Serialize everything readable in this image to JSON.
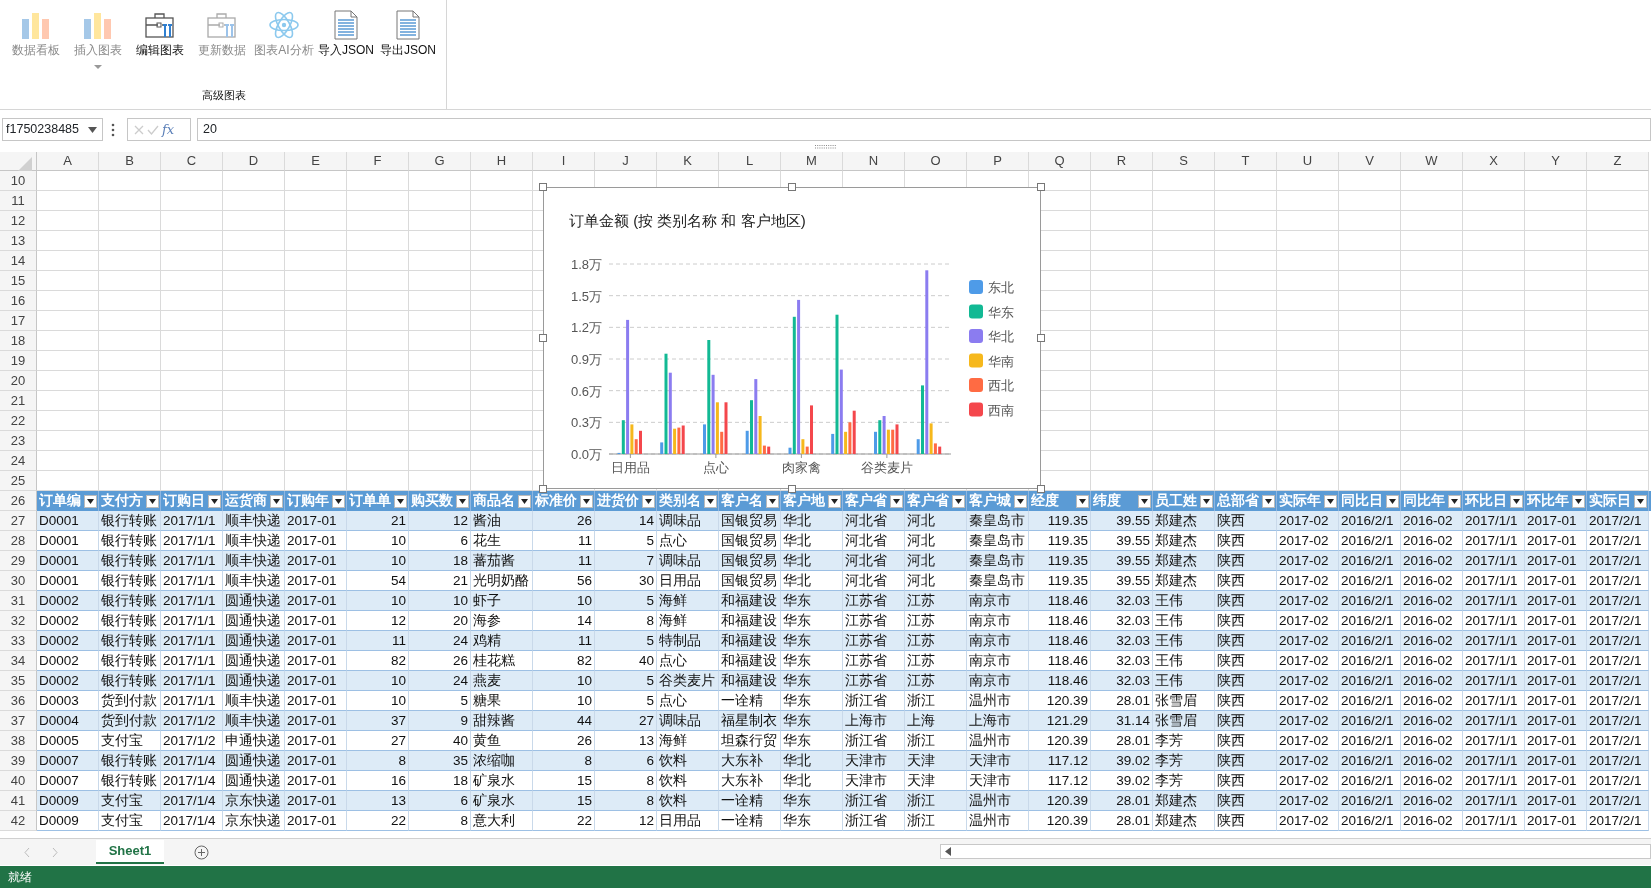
{
  "ribbon": {
    "buttons": [
      {
        "label": "数据看板",
        "kind": "bars",
        "disabled": true,
        "dropdown": false
      },
      {
        "label": "插入图表",
        "kind": "bars",
        "disabled": true,
        "dropdown": true
      },
      {
        "label": "编辑图表",
        "kind": "toolbox",
        "disabled": false,
        "dropdown": false
      },
      {
        "label": "更新数据",
        "kind": "toolbox",
        "disabled": true,
        "dropdown": false
      },
      {
        "label": "图表AI分析",
        "kind": "atom",
        "disabled": true,
        "dropdown": false
      },
      {
        "label": "导入JSON",
        "kind": "document",
        "disabled": false,
        "dropdown": false
      },
      {
        "label": "导出JSON",
        "kind": "document",
        "disabled": false,
        "dropdown": false
      }
    ],
    "group_label": "高级图表"
  },
  "formula_bar": {
    "name_box": "f1750238485",
    "fx_label": "fx",
    "value": "20"
  },
  "sheet": {
    "columns": [
      "A",
      "B",
      "C",
      "D",
      "E",
      "F",
      "G",
      "H",
      "I",
      "J",
      "K",
      "L",
      "M",
      "N",
      "O",
      "P",
      "Q",
      "R",
      "S",
      "T",
      "U",
      "V",
      "W",
      "X",
      "Y",
      "Z"
    ],
    "empty_rows": [
      "10",
      "11",
      "12",
      "13",
      "14",
      "15",
      "16",
      "17",
      "18",
      "19",
      "20",
      "21",
      "22",
      "23",
      "24",
      "25"
    ],
    "table": {
      "header_row": "26",
      "headers": [
        "订单编",
        "支付方",
        "订购日",
        "运货商",
        "订购年",
        "订单单",
        "购买数",
        "商品名",
        "标准价",
        "进货价",
        "类别名",
        "客户名",
        "客户地",
        "客户省",
        "客户省",
        "客户城",
        "经度",
        "纬度",
        "员工姓",
        "总部省",
        "实际年",
        "同比日",
        "同比年",
        "环比日",
        "环比年",
        "实际日"
      ],
      "rows": [
        {
          "number": "27",
          "cells": [
            "D0001",
            "银行转账",
            "2017/1/1",
            "顺丰快递",
            "2017-01",
            "21",
            "12",
            "酱油",
            "26",
            "14",
            "调味品",
            "国银贸易",
            "华北",
            "河北省",
            "河北",
            "秦皇岛市",
            "119.35",
            "39.55",
            "郑建杰",
            "陕西",
            "2017-02",
            "2016/2/1",
            "2016-02",
            "2017/1/1",
            "2017-01",
            "2017/2/1"
          ]
        },
        {
          "number": "28",
          "cells": [
            "D0001",
            "银行转账",
            "2017/1/1",
            "顺丰快递",
            "2017-01",
            "10",
            "6",
            "花生",
            "11",
            "5",
            "点心",
            "国银贸易",
            "华北",
            "河北省",
            "河北",
            "秦皇岛市",
            "119.35",
            "39.55",
            "郑建杰",
            "陕西",
            "2017-02",
            "2016/2/1",
            "2016-02",
            "2017/1/1",
            "2017-01",
            "2017/2/1"
          ]
        },
        {
          "number": "29",
          "cells": [
            "D0001",
            "银行转账",
            "2017/1/1",
            "顺丰快递",
            "2017-01",
            "10",
            "18",
            "蕃茄酱",
            "11",
            "7",
            "调味品",
            "国银贸易",
            "华北",
            "河北省",
            "河北",
            "秦皇岛市",
            "119.35",
            "39.55",
            "郑建杰",
            "陕西",
            "2017-02",
            "2016/2/1",
            "2016-02",
            "2017/1/1",
            "2017-01",
            "2017/2/1"
          ]
        },
        {
          "number": "30",
          "cells": [
            "D0001",
            "银行转账",
            "2017/1/1",
            "顺丰快递",
            "2017-01",
            "54",
            "21",
            "光明奶酪",
            "56",
            "30",
            "日用品",
            "国银贸易",
            "华北",
            "河北省",
            "河北",
            "秦皇岛市",
            "119.35",
            "39.55",
            "郑建杰",
            "陕西",
            "2017-02",
            "2016/2/1",
            "2016-02",
            "2017/1/1",
            "2017-01",
            "2017/2/1"
          ]
        },
        {
          "number": "31",
          "cells": [
            "D0002",
            "银行转账",
            "2017/1/1",
            "圆通快递",
            "2017-01",
            "10",
            "10",
            "虾子",
            "10",
            "5",
            "海鲜",
            "和福建设",
            "华东",
            "江苏省",
            "江苏",
            "南京市",
            "118.46",
            "32.03",
            "王伟",
            "陕西",
            "2017-02",
            "2016/2/1",
            "2016-02",
            "2017/1/1",
            "2017-01",
            "2017/2/1"
          ]
        },
        {
          "number": "32",
          "cells": [
            "D0002",
            "银行转账",
            "2017/1/1",
            "圆通快递",
            "2017-01",
            "12",
            "20",
            "海参",
            "14",
            "8",
            "海鲜",
            "和福建设",
            "华东",
            "江苏省",
            "江苏",
            "南京市",
            "118.46",
            "32.03",
            "王伟",
            "陕西",
            "2017-02",
            "2016/2/1",
            "2016-02",
            "2017/1/1",
            "2017-01",
            "2017/2/1"
          ]
        },
        {
          "number": "33",
          "cells": [
            "D0002",
            "银行转账",
            "2017/1/1",
            "圆通快递",
            "2017-01",
            "11",
            "24",
            "鸡精",
            "11",
            "5",
            "特制品",
            "和福建设",
            "华东",
            "江苏省",
            "江苏",
            "南京市",
            "118.46",
            "32.03",
            "王伟",
            "陕西",
            "2017-02",
            "2016/2/1",
            "2016-02",
            "2017/1/1",
            "2017-01",
            "2017/2/1"
          ]
        },
        {
          "number": "34",
          "cells": [
            "D0002",
            "银行转账",
            "2017/1/1",
            "圆通快递",
            "2017-01",
            "82",
            "26",
            "桂花糕",
            "82",
            "40",
            "点心",
            "和福建设",
            "华东",
            "江苏省",
            "江苏",
            "南京市",
            "118.46",
            "32.03",
            "王伟",
            "陕西",
            "2017-02",
            "2016/2/1",
            "2016-02",
            "2017/1/1",
            "2017-01",
            "2017/2/1"
          ]
        },
        {
          "number": "35",
          "cells": [
            "D0002",
            "银行转账",
            "2017/1/1",
            "圆通快递",
            "2017-01",
            "10",
            "24",
            "燕麦",
            "10",
            "5",
            "谷类麦片",
            "和福建设",
            "华东",
            "江苏省",
            "江苏",
            "南京市",
            "118.46",
            "32.03",
            "王伟",
            "陕西",
            "2017-02",
            "2016/2/1",
            "2016-02",
            "2017/1/1",
            "2017-01",
            "2017/2/1"
          ]
        },
        {
          "number": "36",
          "cells": [
            "D0003",
            "货到付款",
            "2017/1/1",
            "顺丰快递",
            "2017-01",
            "10",
            "5",
            "糖果",
            "10",
            "5",
            "点心",
            "一诠精",
            "华东",
            "浙江省",
            "浙江",
            "温州市",
            "120.39",
            "28.01",
            "张雪眉",
            "陕西",
            "2017-02",
            "2016/2/1",
            "2016-02",
            "2017/1/1",
            "2017-01",
            "2017/2/1"
          ]
        },
        {
          "number": "37",
          "cells": [
            "D0004",
            "货到付款",
            "2017/1/2",
            "顺丰快递",
            "2017-01",
            "37",
            "9",
            "甜辣酱",
            "44",
            "27",
            "调味品",
            "福星制衣",
            "华东",
            "上海市",
            "上海",
            "上海市",
            "121.29",
            "31.14",
            "张雪眉",
            "陕西",
            "2017-02",
            "2016/2/1",
            "2016-02",
            "2017/1/1",
            "2017-01",
            "2017/2/1"
          ]
        },
        {
          "number": "38",
          "cells": [
            "D0005",
            "支付宝",
            "2017/1/2",
            "申通快递",
            "2017-01",
            "27",
            "40",
            "黄鱼",
            "26",
            "13",
            "海鲜",
            "坦森行贸",
            "华东",
            "浙江省",
            "浙江",
            "温州市",
            "120.39",
            "28.01",
            "李芳",
            "陕西",
            "2017-02",
            "2016/2/1",
            "2016-02",
            "2017/1/1",
            "2017-01",
            "2017/2/1"
          ]
        },
        {
          "number": "39",
          "cells": [
            "D0007",
            "银行转账",
            "2017/1/4",
            "圆通快递",
            "2017-01",
            "8",
            "35",
            "浓缩咖",
            "8",
            "6",
            "饮料",
            "大东补",
            "华北",
            "天津市",
            "天津",
            "天津市",
            "117.12",
            "39.02",
            "李芳",
            "陕西",
            "2017-02",
            "2016/2/1",
            "2016-02",
            "2017/1/1",
            "2017-01",
            "2017/2/1"
          ]
        },
        {
          "number": "40",
          "cells": [
            "D0007",
            "银行转账",
            "2017/1/4",
            "圆通快递",
            "2017-01",
            "16",
            "18",
            "矿泉水",
            "15",
            "8",
            "饮料",
            "大东补",
            "华北",
            "天津市",
            "天津",
            "天津市",
            "117.12",
            "39.02",
            "李芳",
            "陕西",
            "2017-02",
            "2016/2/1",
            "2016-02",
            "2017/1/1",
            "2017-01",
            "2017/2/1"
          ]
        },
        {
          "number": "41",
          "cells": [
            "D0009",
            "支付宝",
            "2017/1/4",
            "京东快递",
            "2017-01",
            "13",
            "6",
            "矿泉水",
            "15",
            "8",
            "饮料",
            "一诠精",
            "华东",
            "浙江省",
            "浙江",
            "温州市",
            "120.39",
            "28.01",
            "郑建杰",
            "陕西",
            "2017-02",
            "2016/2/1",
            "2016-02",
            "2017/1/1",
            "2017-01",
            "2017/2/1"
          ]
        },
        {
          "number": "42",
          "cells": [
            "D0009",
            "支付宝",
            "2017/1/4",
            "京东快递",
            "2017-01",
            "22",
            "8",
            "意大利",
            "22",
            "12",
            "日用品",
            "一诠精",
            "华东",
            "浙江省",
            "浙江",
            "温州市",
            "120.39",
            "28.01",
            "郑建杰",
            "陕西",
            "2017-02",
            "2016/2/1",
            "2016-02",
            "2017/1/1",
            "2017-01",
            "2017/2/1"
          ]
        }
      ]
    }
  },
  "chart": {
    "chart_data": {
      "type": "bar",
      "title": "订单金额 (按 类别名称 和 客户地区)",
      "categories": [
        "日用品",
        null,
        "点心",
        null,
        "肉家禽",
        null,
        "谷类麦片",
        null
      ],
      "stacked": false,
      "grid": true,
      "legend": true,
      "ylim": [
        0,
        1.8
      ],
      "yticks": [
        {
          "value": 0,
          "label": "0.0万"
        },
        {
          "value": 0.3,
          "label": "0.3万"
        },
        {
          "value": 0.6,
          "label": "0.6万"
        },
        {
          "value": 0.9,
          "label": "0.9万"
        },
        {
          "value": 1.2,
          "label": "1.2万"
        },
        {
          "value": 1.5,
          "label": "1.5万"
        },
        {
          "value": 1.8,
          "label": "1.8万"
        }
      ],
      "series": [
        {
          "name": "东北",
          "color": "#4e9be8",
          "values": [
            0.01,
            0.11,
            0.28,
            0.22,
            0.06,
            0.19,
            0.21,
            0.14
          ]
        },
        {
          "name": "华东",
          "color": "#12b994",
          "values": [
            0.32,
            0.95,
            1.08,
            0.51,
            1.3,
            1.32,
            0.32,
            0.65
          ]
        },
        {
          "name": "华北",
          "color": "#8b7cf0",
          "values": [
            1.27,
            0.77,
            0.75,
            0.71,
            1.46,
            0.8,
            0.36,
            1.74
          ]
        },
        {
          "name": "华南",
          "color": "#f6b81c",
          "values": [
            0.28,
            0.24,
            0.49,
            0.36,
            0.14,
            0.21,
            0.23,
            0.29
          ]
        },
        {
          "name": "西北",
          "color": "#ff6b43",
          "values": [
            0.14,
            0.25,
            0.21,
            0.08,
            0.07,
            0.3,
            0.23,
            0.1
          ]
        },
        {
          "name": "西南",
          "color": "#f4474c",
          "values": [
            0.22,
            0.27,
            0.49,
            0.07,
            0.46,
            0.41,
            0.28,
            0.07
          ]
        }
      ]
    }
  },
  "sheet_tabs": [
    {
      "label": "Sheet1",
      "selected": true
    }
  ],
  "status_bar": {
    "text": "就绪"
  }
}
